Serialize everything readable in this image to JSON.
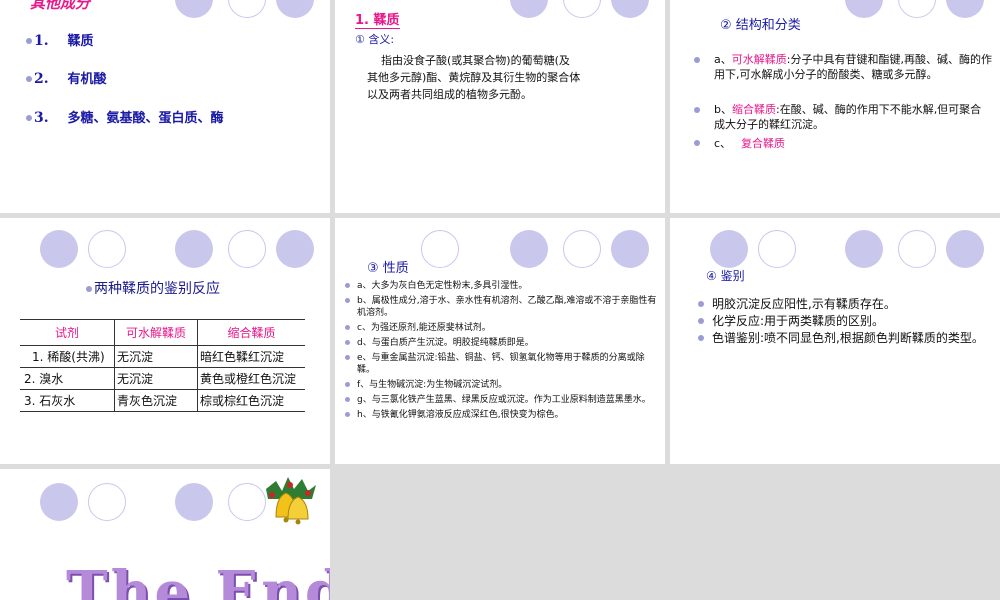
{
  "colors": {
    "accent_pink": "#e8198b",
    "heading_blue": "#1a1aa6",
    "dark_blue": "#1c1c8c",
    "circle_fill": "#c9c8ec"
  },
  "s1": {
    "title": "其他成分",
    "items": [
      {
        "num": "1.",
        "text": "鞣质"
      },
      {
        "num": "2.",
        "text": "有机酸"
      },
      {
        "num": "3.",
        "text": "多糖、氨基酸、蛋白质、酶"
      }
    ]
  },
  "s2": {
    "heading": "1. 鞣质",
    "sub": "① 含义:",
    "para1": "指由没食子酸(或其聚合物)的葡萄糖(及",
    "para2": "其他多元醇)酯、黄烷醇及其衍生物的聚合体",
    "para3": "以及两者共同组成的植物多元酚。"
  },
  "s3": {
    "heading": "② 结构和分类",
    "a_prefix": "a、",
    "a_term": "可水解鞣质",
    "a_text": ":分子中具有苷键和酯键,再酸、碱、酶的作用下,可水解成小分子的酚酸类、糖或多元醇。",
    "b_prefix": "b、",
    "b_term": "缩合鞣质",
    "b_text": ":在酸、碱、酶的作用下不能水解,但可聚合成大分子的鞣红沉淀。",
    "c_prefix": "c、",
    "c_term": "复合鞣质"
  },
  "s4": {
    "title": "两种鞣质的鉴别反应",
    "headers": [
      "试剂",
      "可水解鞣质",
      "缩合鞣质"
    ],
    "rows": [
      [
        "1. 稀酸(共沸)",
        "无沉淀",
        "暗红色鞣红沉淀"
      ],
      [
        "2. 溴水",
        "无沉淀",
        "黄色或橙红色沉淀"
      ],
      [
        "3. 石灰水",
        "青灰色沉淀",
        "棕或棕红色沉淀"
      ]
    ]
  },
  "s5": {
    "heading": "③ 性质",
    "items": [
      "a、大多为灰白色无定性粉末,多具引湿性。",
      "b、属极性成分,溶于水、亲水性有机溶剂、乙酸乙酯,难溶或不溶于亲脂性有机溶剂。",
      "c、为强还原剂,能还原斐林试剂。",
      "d、与蛋白质产生沉淀。明胶提纯鞣质即是。",
      "e、与重金属盐沉淀:铅盐、铜盐、钙、钡氢氧化物等用于鞣质的分离或除鞣。",
      "f、与生物碱沉淀:为生物碱沉淀试剂。",
      "g、与三氯化铁产生蓝黑、绿黑反应或沉淀。作为工业原料制造蓝黑墨水。",
      "h、与铁氰化钾氨溶液反应成深红色,很快变为棕色。"
    ]
  },
  "s6": {
    "heading": "④ 鉴别",
    "items": [
      "明胶沉淀反应阳性,示有鞣质存在。",
      "化学反应:用于两类鞣质的区别。",
      "色谱鉴别:喷不同显色剂,根据颜色判断鞣质的类型。"
    ]
  },
  "s7": {
    "end_text": "The End",
    "icon": "bell-icon"
  }
}
